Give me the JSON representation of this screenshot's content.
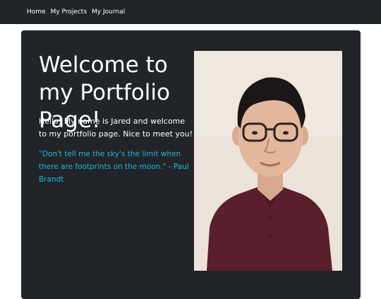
{
  "nav": {
    "items": [
      {
        "label": "Home"
      },
      {
        "label": "My Projects"
      },
      {
        "label": "My Journal"
      }
    ]
  },
  "hero": {
    "title": "Welcome to my Portfolio Page!",
    "intro": "Hello! My name is Jared and welcome to my portfolio page. Nice to meet you!",
    "quote": "\"Don't tell me the sky's the limit when there are footprints on the moon.\" - Paul Brandt"
  },
  "colors": {
    "navbar_bg": "#212529",
    "card_bg": "#212529",
    "quote": "#1fb7d6",
    "text": "#ffffff"
  }
}
